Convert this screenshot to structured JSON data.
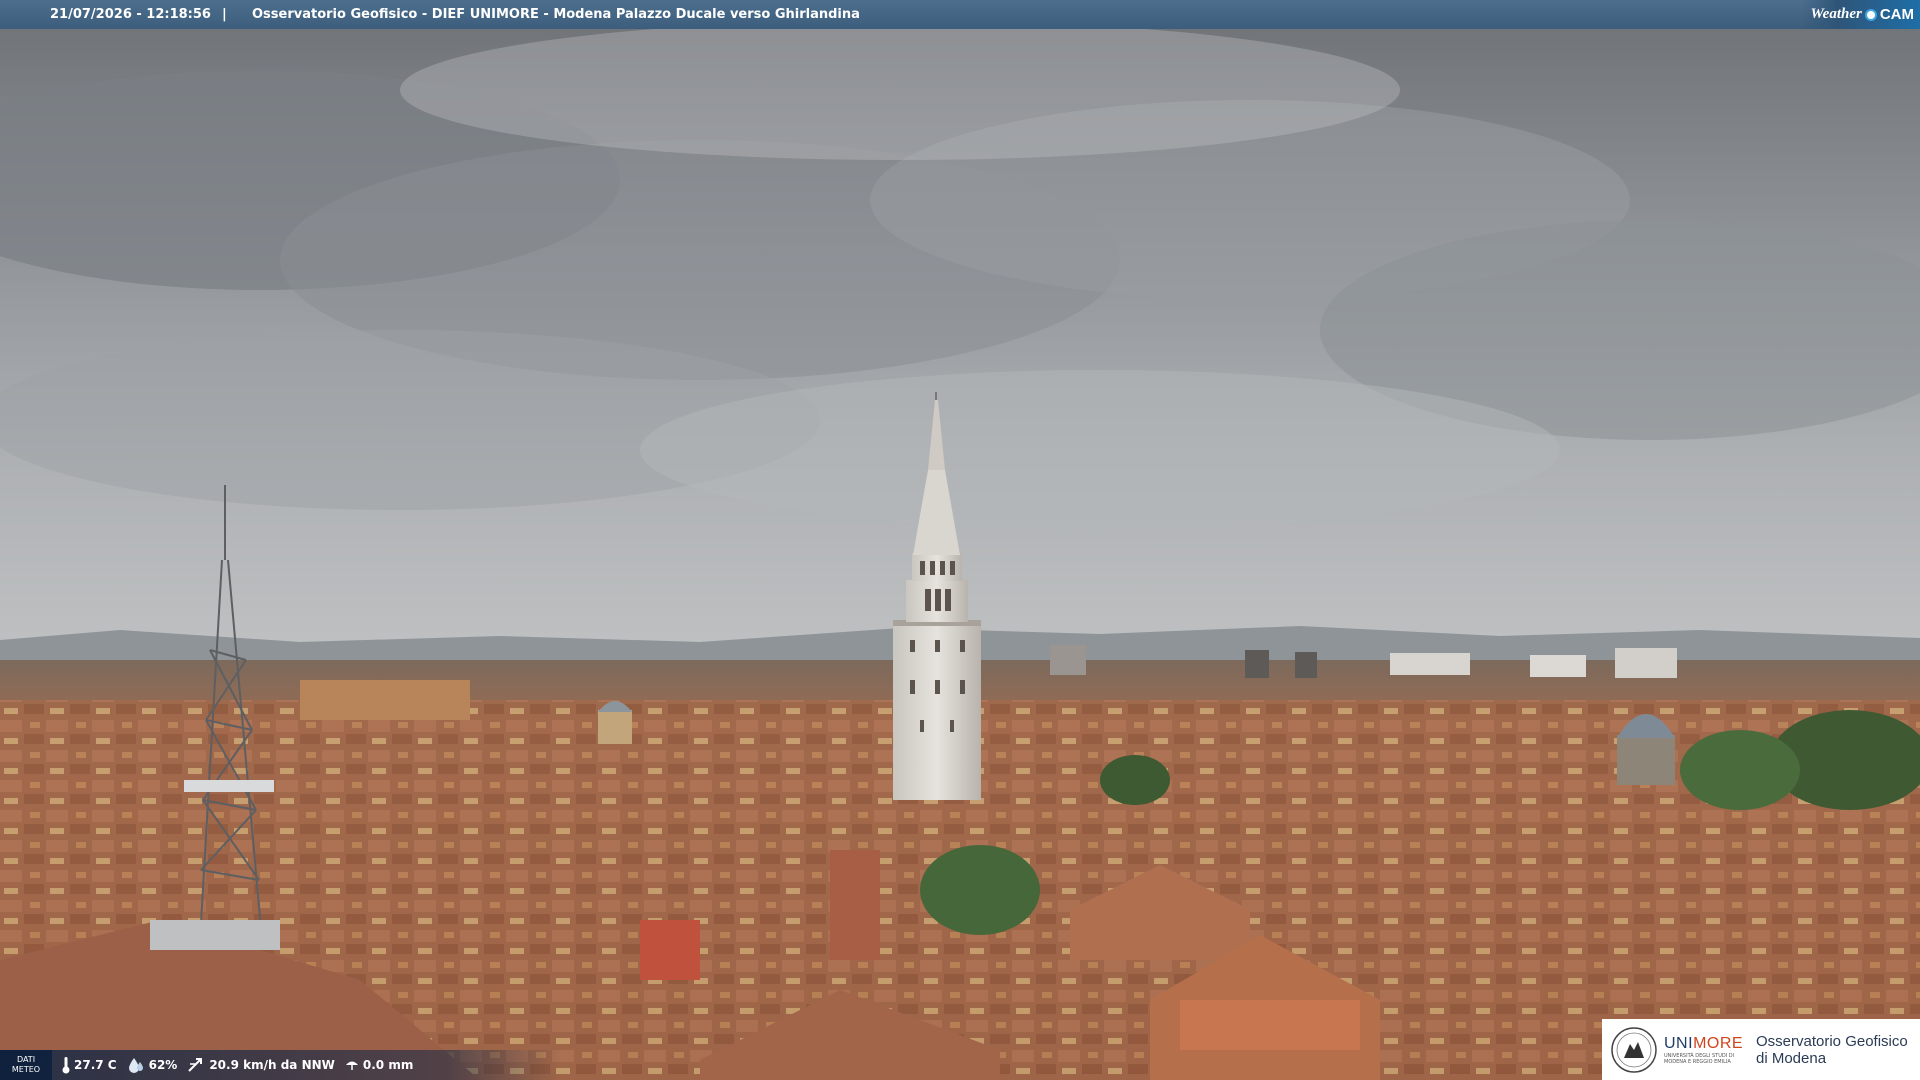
{
  "caption": {
    "timestamp": "21/07/2026 - 12:18:56",
    "separator": "|",
    "title": "Osservatorio Geofisico - DIEF UNIMORE - Modena Palazzo Ducale verso Ghirlandina"
  },
  "logo": {
    "weather": "Weather",
    "cam": "CAM"
  },
  "weather_bar": {
    "label_line1": "DATI",
    "label_line2": "METEO",
    "temperature": "27.7 C",
    "humidity": "62%",
    "wind": "20.9 km/h da NNW",
    "rain": "0.0 mm"
  },
  "badge": {
    "uni_name_a": "UNI",
    "uni_name_b": "MORE",
    "uni_sub": "UNIVERSITÀ DEGLI STUDI DI MODENA E REGGIO EMILIA",
    "observatory_line1": "Osservatorio Geofisico",
    "observatory_line2": "di Modena"
  },
  "colors": {
    "caption_bar": "#3f607f",
    "sky": "#a9adb1",
    "roofs": "#a86a4c",
    "tower": "#dcd8d2",
    "unimore_red": "#d0451b",
    "unimore_blue": "#1f3c68"
  },
  "icons": [
    "thermometer-icon",
    "humidity-drop-icon",
    "wind-icon",
    "rain-icon",
    "unimore-seal-icon",
    "weathercam-logo-icon"
  ]
}
